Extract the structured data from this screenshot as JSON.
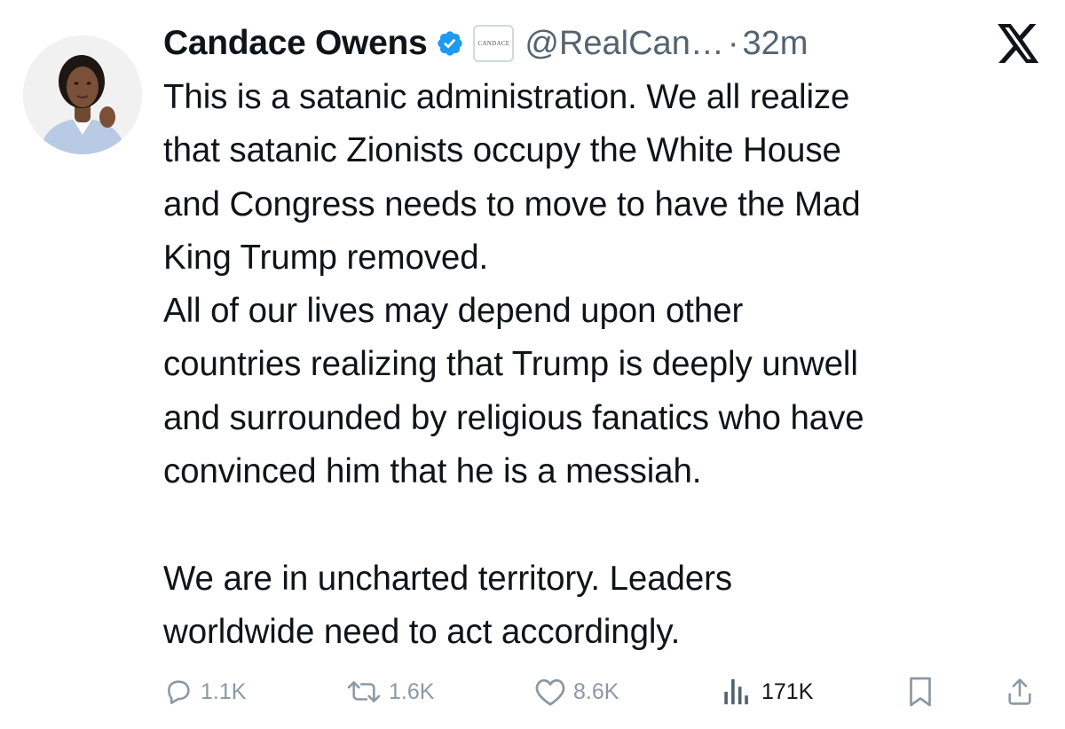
{
  "tweet": {
    "author": {
      "display_name": "Candace Owens",
      "handle": "@RealCan…",
      "affiliate_badge_text": "CANDACE",
      "avatar_icon": "profile-photo"
    },
    "separator": "·",
    "timestamp": "32m",
    "text_lines": [
      "This is a satanic administration. We all realize",
      "that satanic Zionists occupy the White House",
      "and Congress needs to move to have the Mad",
      "King Trump removed.",
      "All of our lives may depend upon other",
      "countries realizing that Trump is deeply unwell",
      "and surrounded by religious fanatics who have",
      "convinced him that he is a messiah.",
      "We are in uncharted territory. Leaders",
      "worldwide need to act accordingly."
    ],
    "actions": {
      "replies": "1.1K",
      "retweets": "1.6K",
      "likes": "8.6K",
      "views": "171K"
    }
  },
  "colors": {
    "text": "#0f1419",
    "secondary": "#536471",
    "faded_action": "#8b98a5",
    "verified": "#1d9bf0",
    "background": "#ffffff"
  },
  "icons": {
    "verified": "verified-check-icon",
    "platform": "x-logo-icon",
    "reply": "reply-bubble-icon",
    "retweet": "retweet-icon",
    "like": "heart-icon",
    "views": "views-bar-chart-icon",
    "bookmark": "bookmark-icon",
    "share": "share-icon"
  }
}
